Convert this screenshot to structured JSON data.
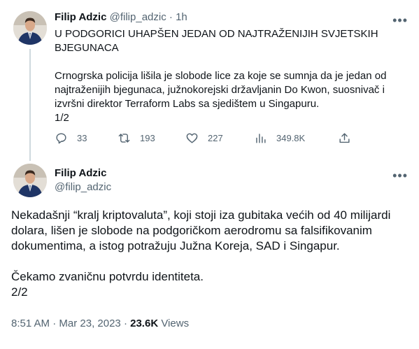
{
  "tweet1": {
    "author_name": "Filip Adzic",
    "handle": "@filip_adzic",
    "separator": "·",
    "time_ago": "1h",
    "title": "U PODGORICI UHAPŠEN JEDAN OD NAJTRAŽENIJIH SVJETSKIH BJEGUNACA",
    "body": "Crnogrska policija lišila je slobode lice za koje se sumnja da je jedan od najtraženijih bjegunaca, južnokorejski državljanin Do Kwon, suosnivač i izvršni direktor Terraform Labs sa sjedištem u Singapuru.",
    "thread_count": "1/2",
    "replies": "33",
    "retweets": "193",
    "likes": "227",
    "views": "349.8K"
  },
  "tweet2": {
    "author_name": "Filip Adzic",
    "handle": "@filip_adzic",
    "paragraph1": "Nekadašnji “kralj kriptovaluta”, koji stoji iza gubitaka većih od 40 milijardi dolara, lišen je slobode na podgoričkom aerodromu sa falsifikovanim dokumentima, a istog potražuju Južna Koreja, SAD i Singapur.",
    "paragraph2": "Čekamo zvaničnu potvrdu identiteta.",
    "thread_count": "2/2",
    "time": "8:51 AM",
    "dot1": "·",
    "date": "Mar 23, 2023",
    "dot2": "·",
    "views_count": "23.6K",
    "views_label": "Views"
  },
  "icons": {
    "more": "more-horizontal-icon",
    "reply": "reply-icon",
    "retweet": "retweet-icon",
    "like": "heart-icon",
    "views": "analytics-icon",
    "share": "share-icon"
  },
  "colors": {
    "text": "#0f1419",
    "muted": "#536471",
    "thread_line": "#cfd9de",
    "suit": "#1f3566",
    "background": "#ffffff"
  }
}
